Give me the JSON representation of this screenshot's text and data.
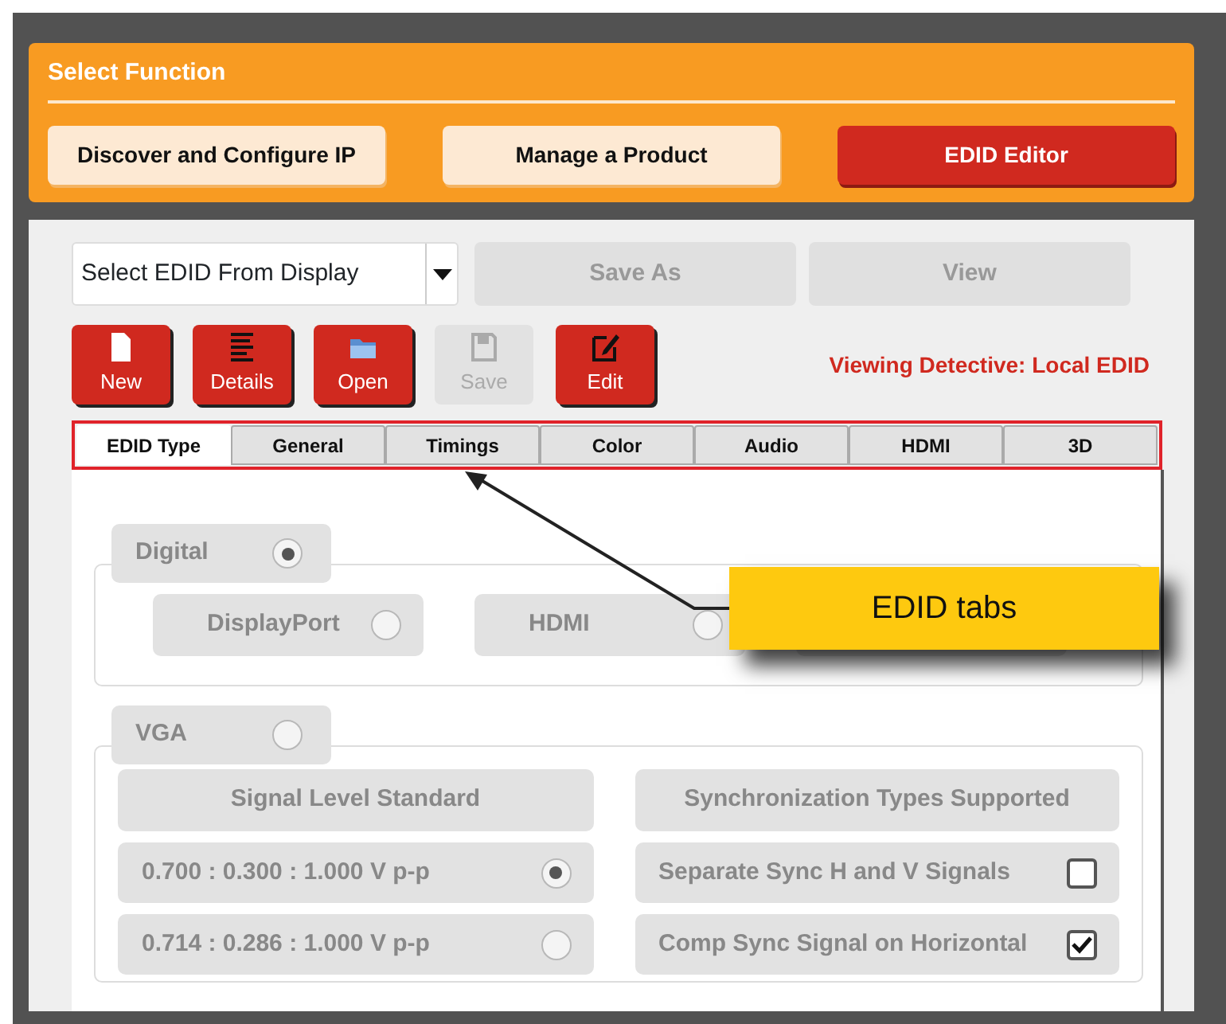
{
  "select_function": {
    "title": "Select Function",
    "buttons": [
      {
        "label": "Discover and Configure IP",
        "selected": false
      },
      {
        "label": "Manage a Product",
        "selected": false
      },
      {
        "label": "EDID Editor",
        "selected": true
      }
    ]
  },
  "edid_source": {
    "value": "Select EDID From Display"
  },
  "actions": [
    {
      "label": "Save As",
      "disabled": true
    },
    {
      "label": "View",
      "disabled": true
    }
  ],
  "toolbar": [
    {
      "label": "New",
      "disabled": false
    },
    {
      "label": "Details",
      "disabled": false
    },
    {
      "label": "Open",
      "disabled": false
    },
    {
      "label": "Save",
      "disabled": true
    },
    {
      "label": "Edit",
      "disabled": false
    }
  ],
  "status": "Viewing Detective: Local EDID",
  "tabs": [
    {
      "label": "EDID Type",
      "selected": true
    },
    {
      "label": "General",
      "selected": false
    },
    {
      "label": "Timings",
      "selected": false
    },
    {
      "label": "Color",
      "selected": false
    },
    {
      "label": "Audio",
      "selected": false
    },
    {
      "label": "HDMI",
      "selected": false
    },
    {
      "label": "3D",
      "selected": false
    }
  ],
  "digital": {
    "label": "Digital",
    "selected": true,
    "options": [
      {
        "label": "DisplayPort",
        "selected": false
      },
      {
        "label": "HDMI",
        "selected": false
      }
    ]
  },
  "vga": {
    "label": "VGA",
    "selected": false,
    "signal_level": {
      "title": "Signal Level Standard",
      "options": [
        {
          "label": "0.700 : 0.300 : 1.000 V p-p",
          "selected": true
        },
        {
          "label": "0.714 : 0.286 : 1.000 V p-p",
          "selected": false
        }
      ]
    },
    "sync": {
      "title": "Synchronization Types Supported",
      "options": [
        {
          "label": "Separate Sync H and V Signals",
          "checked": false
        },
        {
          "label": "Comp Sync Signal on Horizontal",
          "checked": true
        }
      ]
    }
  },
  "callout": {
    "text": "EDID tabs"
  }
}
